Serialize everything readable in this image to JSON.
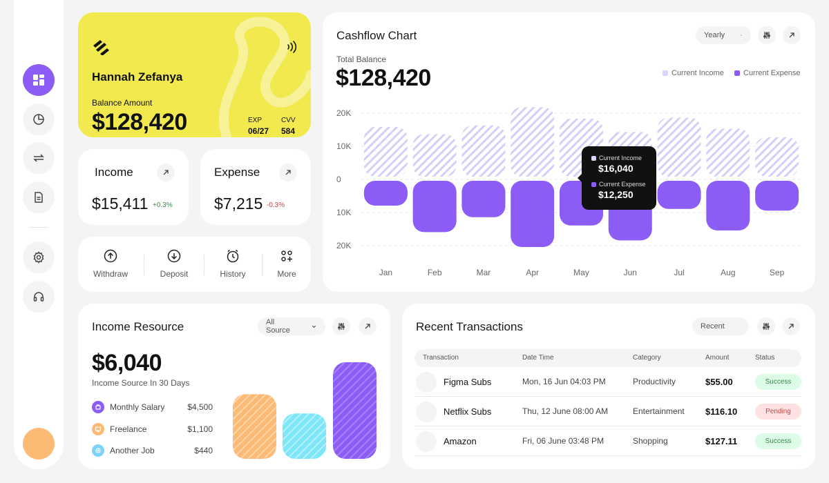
{
  "sidebar": {
    "items": [
      {
        "icon": "dashboard-icon",
        "active": true
      },
      {
        "icon": "pie-chart-icon"
      },
      {
        "icon": "transfer-icon"
      },
      {
        "icon": "document-icon"
      },
      {
        "icon": "settings-icon"
      },
      {
        "icon": "headset-icon"
      }
    ],
    "accent": "#8b5cf6"
  },
  "balance_card": {
    "name": "Hannah Zefanya",
    "balance_label": "Balance Amount",
    "balance": "$128,420",
    "exp_label": "EXP",
    "exp_value": "06/27",
    "cvv_label": "CVV",
    "cvv_value": "584",
    "color": "#f2e94e"
  },
  "income": {
    "title": "Income",
    "value": "$15,411",
    "change": "+0.3%"
  },
  "expense": {
    "title": "Expense",
    "value": "$7,215",
    "change": "-0.3%"
  },
  "actions": [
    {
      "label": "Withdraw",
      "icon": "upload-arrow-icon"
    },
    {
      "label": "Deposit",
      "icon": "download-arrow-icon"
    },
    {
      "label": "History",
      "icon": "clock-icon"
    },
    {
      "label": "More",
      "icon": "grid-plus-icon"
    }
  ],
  "cashflow": {
    "title": "Cashflow Chart",
    "period": "Yearly",
    "total_label": "Total Balance",
    "total": "$128,420",
    "legend_income": "Current Income",
    "legend_expense": "Current Expense",
    "tooltip": {
      "income_label": "Current Income",
      "income_value": "$16,040",
      "expense_label": "Current Expense",
      "expense_value": "$12,250"
    }
  },
  "chart_data": {
    "type": "bar",
    "categories": [
      "Jan",
      "Feb",
      "Mar",
      "Apr",
      "May",
      "Jun",
      "Jul",
      "Aug",
      "Sep"
    ],
    "series": [
      {
        "name": "Current Income",
        "values": [
          15000,
          12800,
          15500,
          21000,
          17500,
          13500,
          17800,
          14500,
          11900
        ],
        "color": "#c9baf5"
      },
      {
        "name": "Current Expense",
        "values": [
          -7500,
          -15500,
          -11000,
          -20000,
          -13500,
          -18000,
          -8500,
          -15000,
          -9000
        ],
        "color": "#8b5cf6"
      }
    ],
    "y_tick_labels": [
      "20K",
      "10K",
      "0",
      "10K",
      "20K"
    ],
    "ylim": [
      -20000,
      20000
    ],
    "grid": true,
    "legend_position": "top-right",
    "title": "Cashflow Chart"
  },
  "income_resource": {
    "title": "Income Resource",
    "filter": "All Source",
    "amount": "$6,040",
    "subtitle": "Income Source In 30 Days",
    "items": [
      {
        "name": "Monthly Salary",
        "value": "$4,500",
        "color": "#8b5cf6"
      },
      {
        "name": "Freelance",
        "value": "$1,100",
        "color": "#fdba74"
      },
      {
        "name": "Another Job",
        "value": "$440",
        "color": "#7dd3fc"
      }
    ],
    "bars": [
      {
        "name": "Freelance",
        "level": 0.67,
        "color": "#fdba74"
      },
      {
        "name": "Another Job",
        "level": 0.47,
        "color": "#7de6f8"
      },
      {
        "name": "Monthly Salary",
        "level": 1.0,
        "color": "#8b5cf6"
      }
    ]
  },
  "transactions": {
    "title": "Recent Transactions",
    "filter": "Recent",
    "columns": [
      "Transaction",
      "Date Time",
      "Category",
      "Amount",
      "Status"
    ],
    "rows": [
      {
        "name": "Figma Subs",
        "date": "Mon, 16 Jun 04:03 PM",
        "category": "Productivity",
        "amount": "$55.00",
        "status": "Success"
      },
      {
        "name": "Netflix Subs",
        "date": "Thu, 12 June 08:00 AM",
        "category": "Entertainment",
        "amount": "$116.10",
        "status": "Pending"
      },
      {
        "name": "Amazon",
        "date": "Fri, 06 June 03:48 PM",
        "category": "Shopping",
        "amount": "$127.11",
        "status": "Success"
      }
    ]
  }
}
